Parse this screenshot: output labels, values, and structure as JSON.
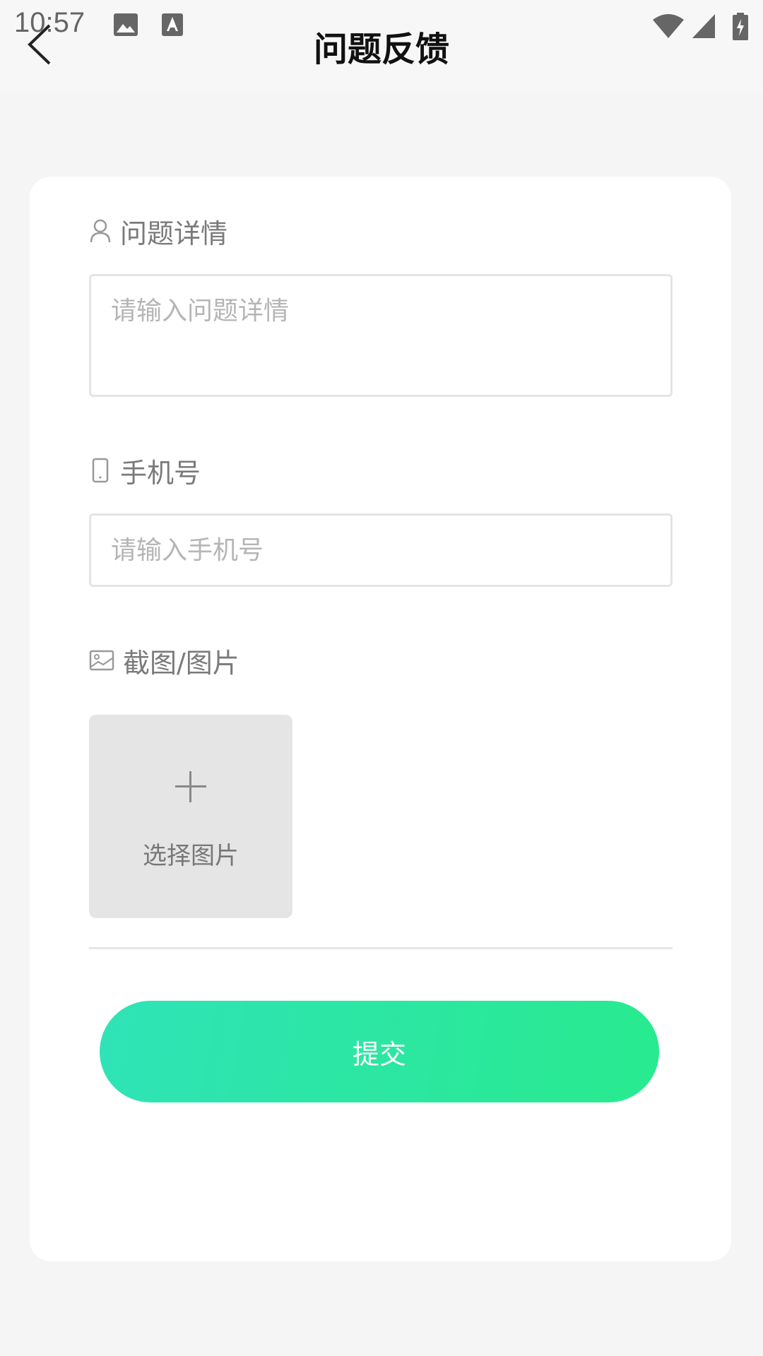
{
  "status_bar": {
    "time": "10:57"
  },
  "header": {
    "title": "问题反馈"
  },
  "form": {
    "detail": {
      "label": "问题详情",
      "placeholder": "请输入问题详情"
    },
    "phone": {
      "label": "手机号",
      "placeholder": "请输入手机号"
    },
    "image": {
      "label": "截图/图片",
      "upload_label": "选择图片"
    },
    "submit_label": "提交"
  },
  "colors": {
    "accent_start": "#2fe3b7",
    "accent_end": "#28ea8e",
    "background": "#f5f5f5"
  }
}
